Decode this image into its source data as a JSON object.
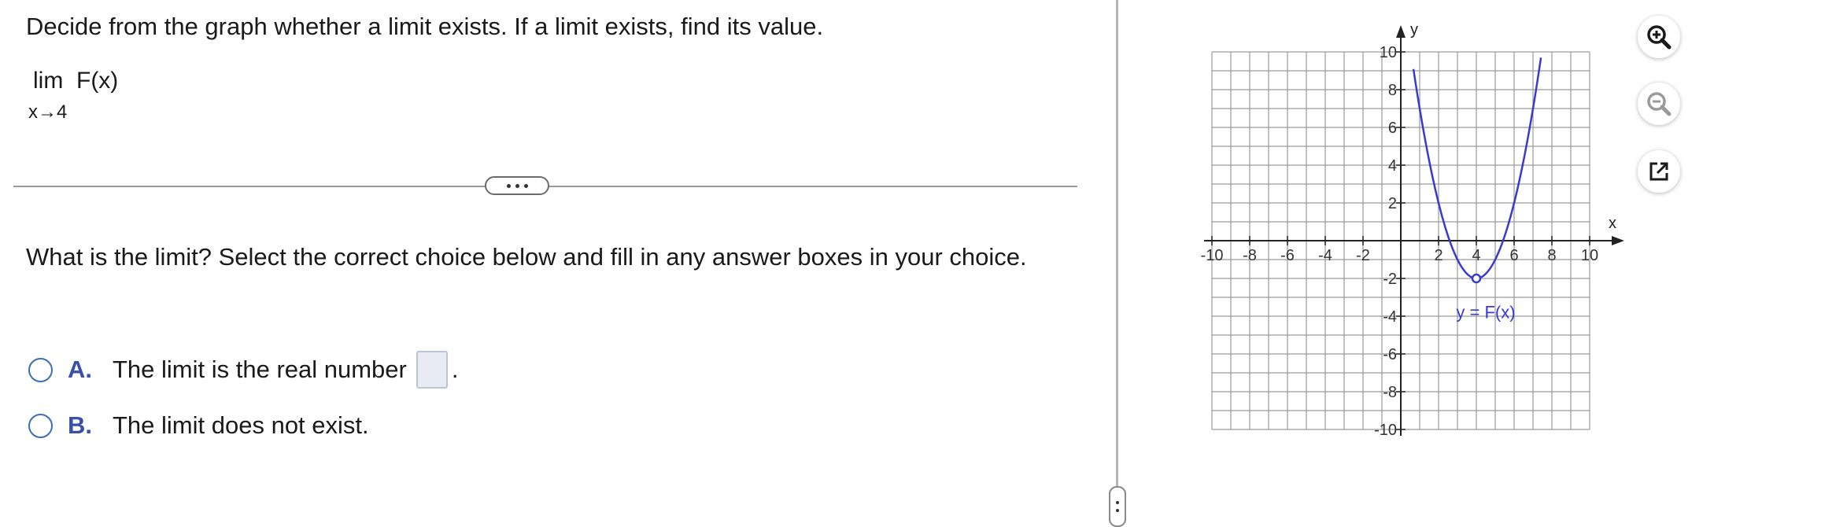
{
  "question": {
    "instruction": "Decide from the graph whether a limit exists. If a limit exists, find its value.",
    "limit_expression": "lim  F(x)",
    "limit_subscript": "x→4"
  },
  "prompt": "What is the limit? Select the correct choice below and fill in any answer boxes in your choice.",
  "choices": [
    {
      "letter": "A.",
      "text": "The limit is the real number",
      "suffix": "."
    },
    {
      "letter": "B.",
      "text": "The limit does not exist."
    }
  ],
  "graph": {
    "x_axis_label": "x",
    "y_axis_label": "y",
    "curve_label": "y = F(x)",
    "curve_color": "#3a3ad0",
    "x_ticks": [
      "-10",
      "-8",
      "-6",
      "-4",
      "-2",
      "2",
      "4",
      "6",
      "8",
      "10"
    ],
    "y_ticks": [
      "10",
      "8",
      "6",
      "4",
      "2",
      "-2",
      "-4",
      "-6",
      "-8",
      "-10"
    ]
  },
  "chart_data": {
    "type": "line",
    "xlim": [
      -10,
      10
    ],
    "ylim": [
      -10,
      10
    ],
    "grid": true,
    "xlabel": "x",
    "ylabel": "y",
    "series": [
      {
        "name": "y = F(x)",
        "formula": "y = (x - 4)^2 - 2",
        "x_range": [
          0.67,
          7.46
        ],
        "hole": {
          "x": 4,
          "y": -2
        }
      }
    ]
  },
  "tools": [
    "zoom-in-icon",
    "zoom-out-icon",
    "popout-icon"
  ]
}
